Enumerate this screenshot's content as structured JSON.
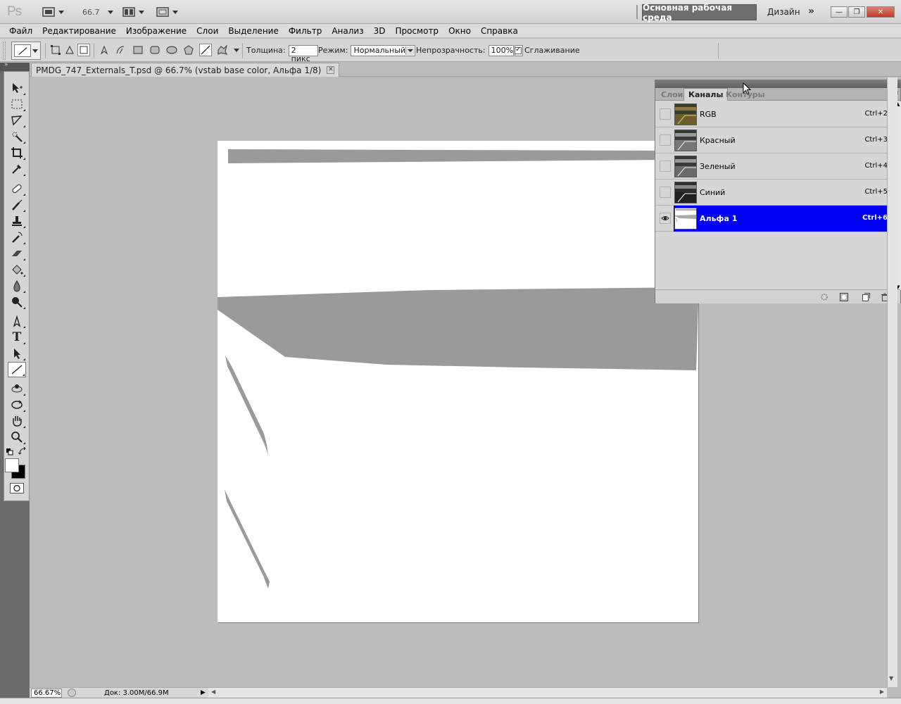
{
  "app": {
    "logo": "Ps",
    "zoom_value": "66.7",
    "workspace_active": "Основная рабочая среда",
    "workspace_design": "Дизайн",
    "more": "»"
  },
  "menu": [
    "Файл",
    "Редактирование",
    "Изображение",
    "Слои",
    "Выделение",
    "Фильтр",
    "Анализ",
    "3D",
    "Просмотр",
    "Окно",
    "Справка"
  ],
  "options": {
    "thickness_label": "Толщина:",
    "thickness_value": "2 пикс",
    "mode_label": "Режим:",
    "mode_value": "Нормальный",
    "opacity_label": "Непрозрачность:",
    "opacity_value": "100%",
    "antialias_label": "Сглаживание"
  },
  "document": {
    "tab_title": "PMDG_747_Externals_T.psd @ 66.7% (vstab base color, Альфа 1/8)"
  },
  "status": {
    "zoom": "66.67%",
    "doc_size": "Док: 3.00M/66.9M"
  },
  "panel": {
    "tabs": [
      "Слои",
      "Каналы",
      "Контуры"
    ],
    "active_tab": "Каналы",
    "channels": [
      {
        "name": "RGB",
        "shortcut": "Ctrl+2",
        "visible": false,
        "selected": false
      },
      {
        "name": "Красный",
        "shortcut": "Ctrl+3",
        "visible": false,
        "selected": false
      },
      {
        "name": "Зеленый",
        "shortcut": "Ctrl+4",
        "visible": false,
        "selected": false
      },
      {
        "name": "Синий",
        "shortcut": "Ctrl+5",
        "visible": false,
        "selected": false
      },
      {
        "name": "Альфа 1",
        "shortcut": "Ctrl+6",
        "visible": true,
        "selected": true
      }
    ]
  },
  "colors": {
    "selection": "#0000f5",
    "canvas_bg": "#bcbcbc",
    "shape_gray": "#9a9a9a",
    "foreground": "#ffffff",
    "background": "#000000"
  }
}
